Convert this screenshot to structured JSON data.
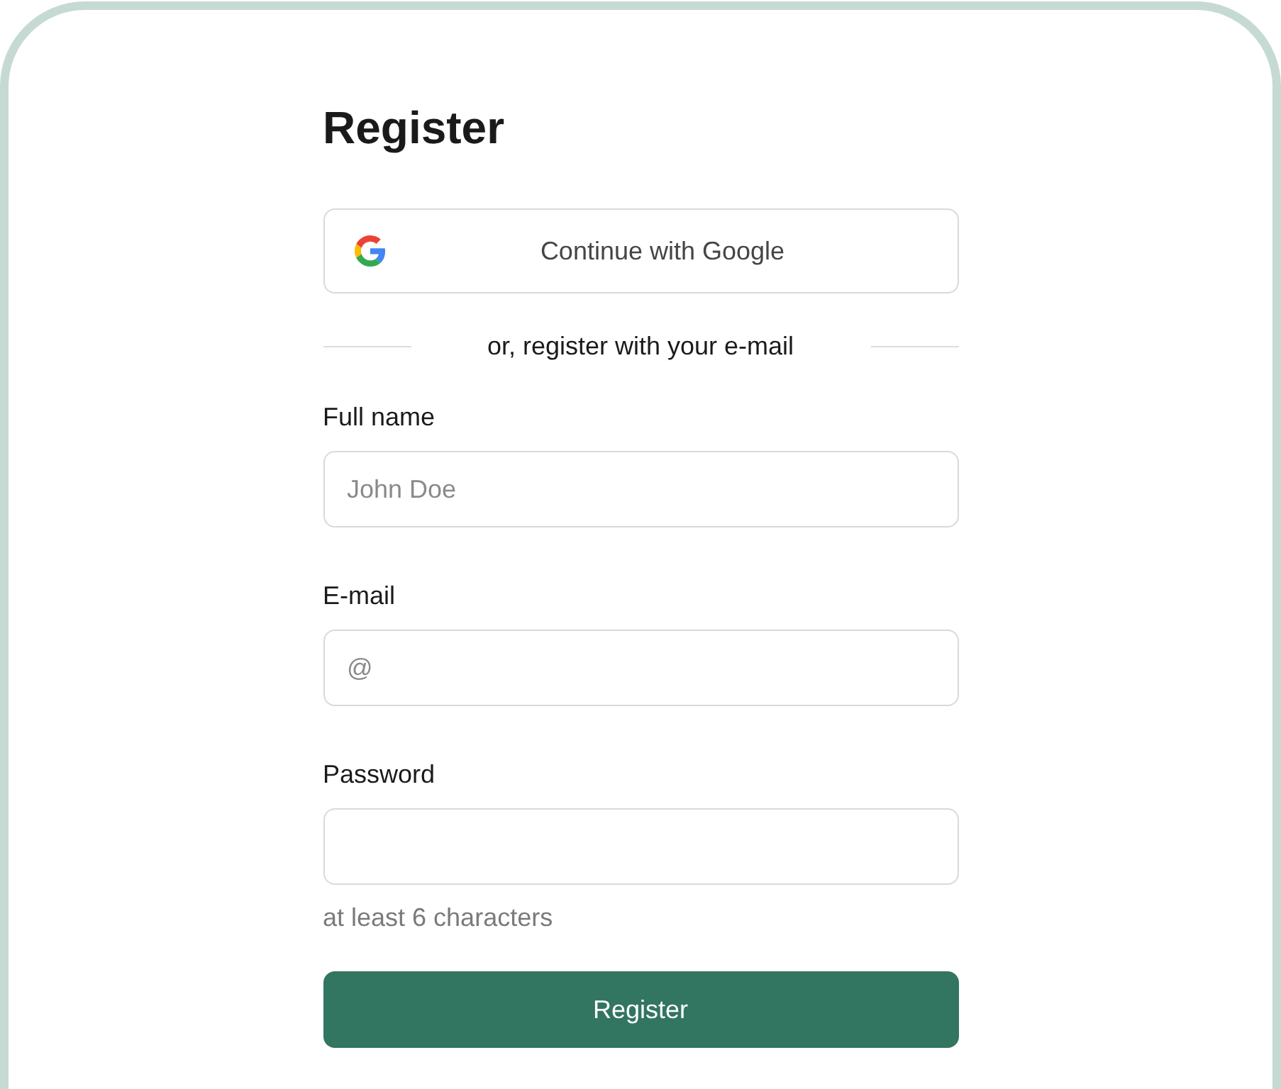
{
  "title": "Register",
  "google_button": {
    "label": "Continue with Google"
  },
  "divider": {
    "label": "or, register with your e-mail"
  },
  "fields": [
    {
      "label": "Full name",
      "placeholder": "John Doe"
    },
    {
      "label": "E-mail",
      "placeholder": "@"
    },
    {
      "label": "Password",
      "hint": "at least 6 characters"
    }
  ],
  "submit_button": {
    "label": "Register"
  }
}
